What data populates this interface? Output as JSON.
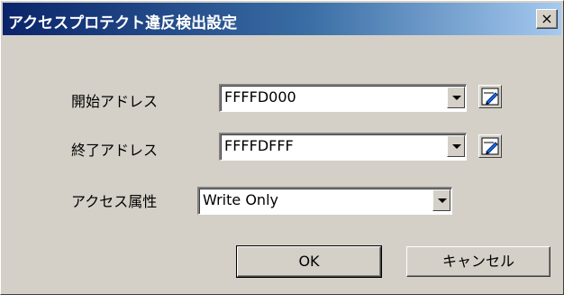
{
  "dialog": {
    "title": "アクセスプロテクト違反検出設定",
    "close_label": "×"
  },
  "fields": {
    "start_address": {
      "label": "開始アドレス",
      "value": "FFFFD000"
    },
    "end_address": {
      "label": "終了アドレス",
      "value": "FFFFDFFF"
    },
    "access_attribute": {
      "label": "アクセス属性",
      "value": "Write Only"
    }
  },
  "buttons": {
    "ok": "OK",
    "cancel": "キャンセル"
  },
  "icons": {
    "edit_icon_name": "pencil-edit-icon"
  }
}
